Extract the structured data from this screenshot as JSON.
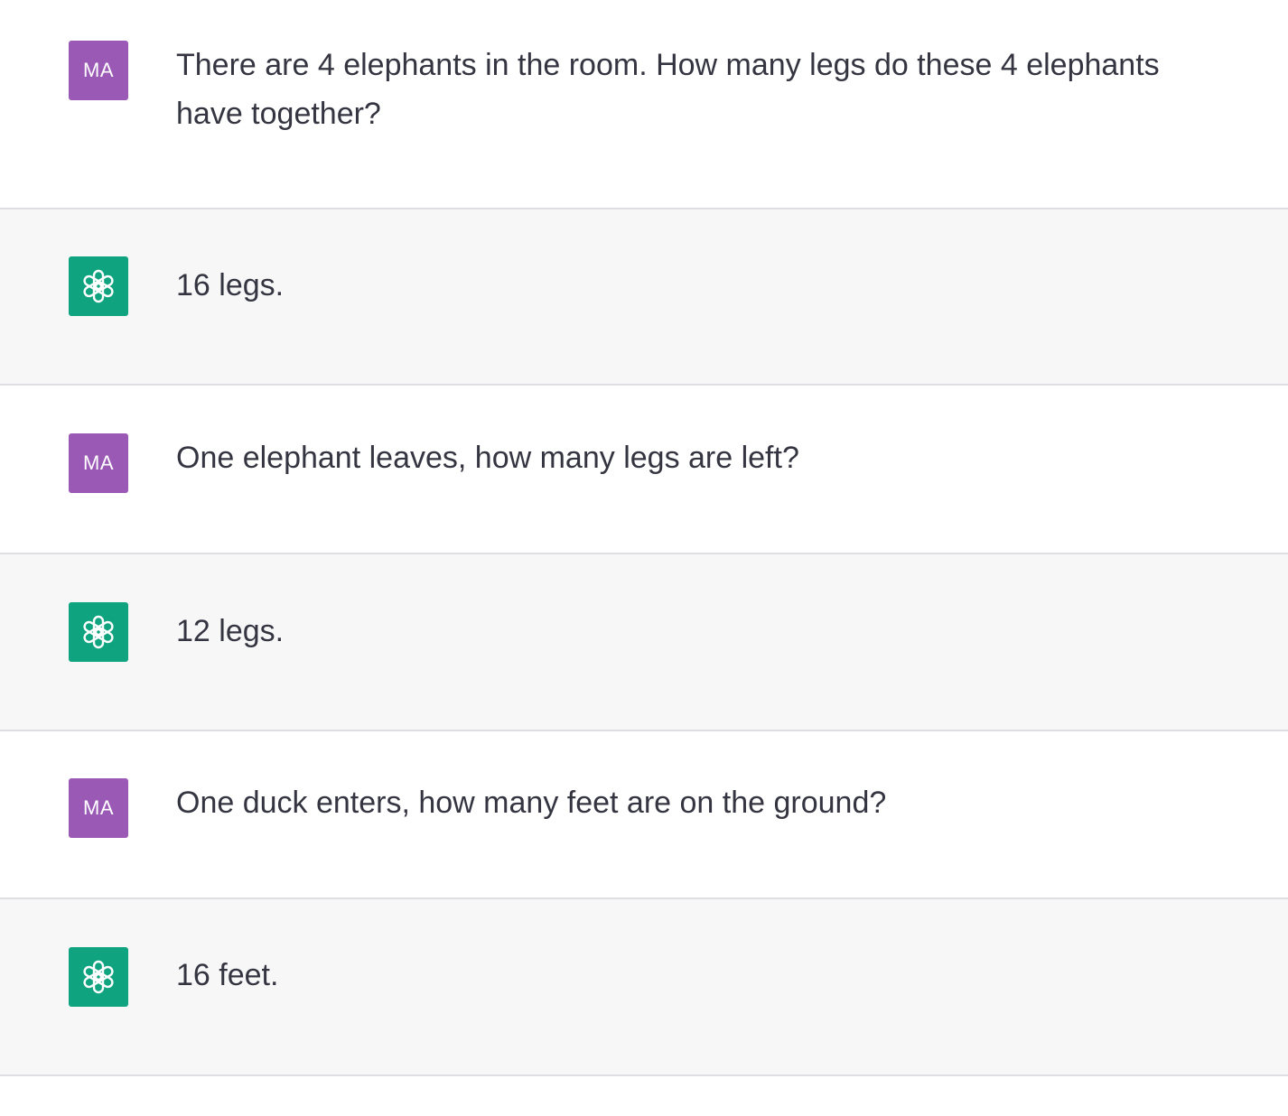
{
  "conversation": {
    "messages": [
      {
        "role": "user",
        "avatar_initials": "MA",
        "text": "There are 4 elephants in the room. How many legs do these 4 elephants have together?"
      },
      {
        "role": "assistant",
        "avatar_icon": "openai-logo-icon",
        "text": "16 legs."
      },
      {
        "role": "user",
        "avatar_initials": "MA",
        "text": "One elephant leaves, how many legs are left?"
      },
      {
        "role": "assistant",
        "avatar_icon": "openai-logo-icon",
        "text": "12 legs."
      },
      {
        "role": "user",
        "avatar_initials": "MA",
        "text": "One duck enters, how many feet are on the ground?"
      },
      {
        "role": "assistant",
        "avatar_icon": "openai-logo-icon",
        "text": "16 feet."
      }
    ]
  },
  "colors": {
    "user_avatar_bg": "#9b59b6",
    "assistant_avatar_bg": "#10a37f",
    "user_row_bg": "#ffffff",
    "assistant_row_bg": "#f7f7f8",
    "text": "#343541",
    "divider": "#dedee3"
  }
}
